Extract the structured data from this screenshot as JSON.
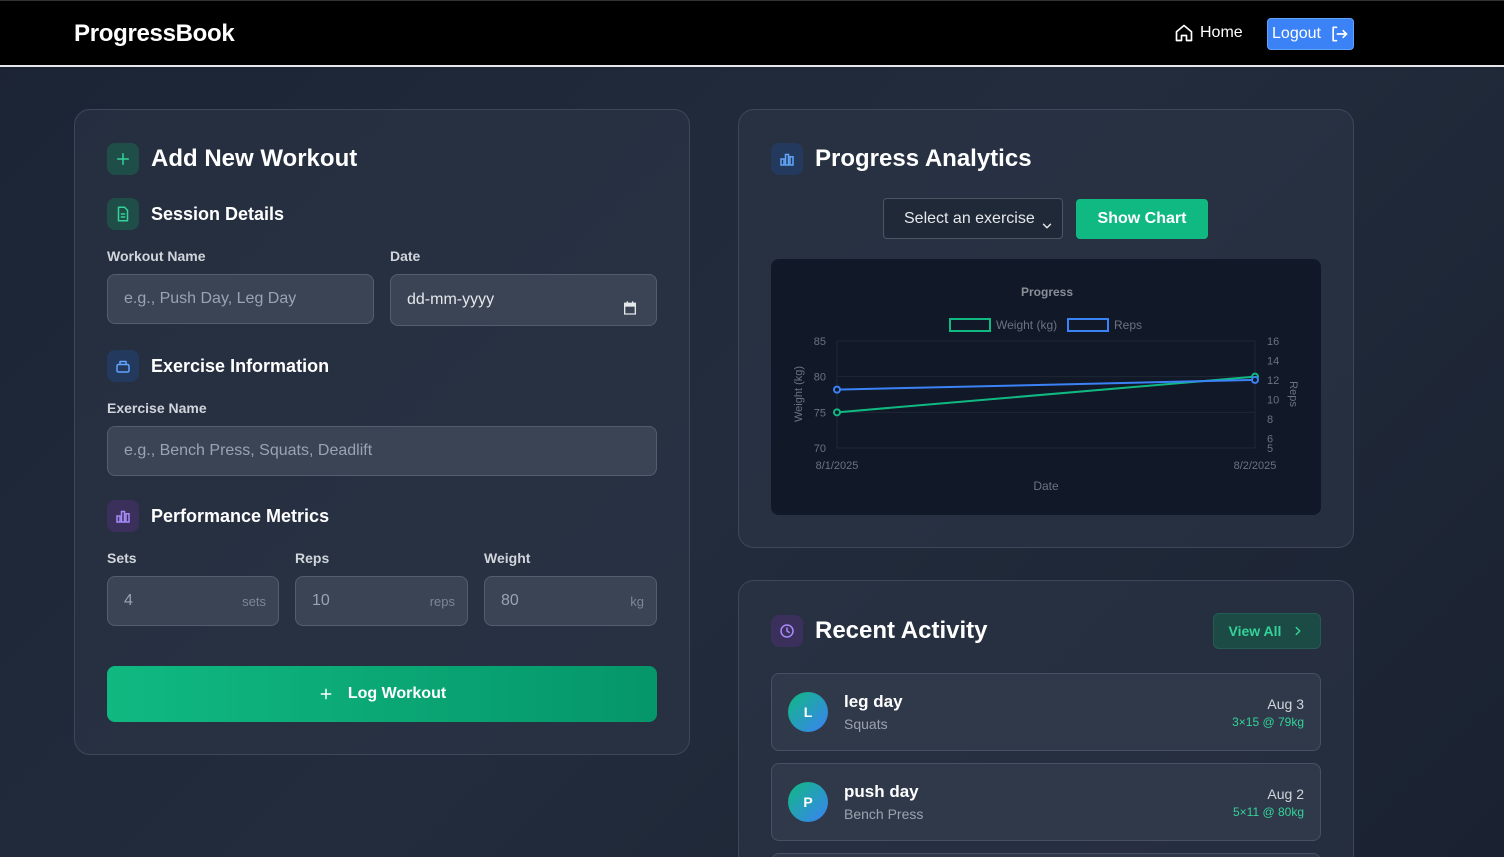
{
  "app": {
    "brand": "ProgressBook"
  },
  "nav": {
    "home_label": "Home",
    "logout_label": "Logout"
  },
  "add_workout": {
    "title": "Add New Workout",
    "session": {
      "title": "Session Details",
      "workout_name_label": "Workout Name",
      "workout_name_placeholder": "e.g., Push Day, Leg Day",
      "date_label": "Date",
      "date_value": "dd-mm-yyyy"
    },
    "exercise": {
      "title": "Exercise Information",
      "name_label": "Exercise Name",
      "name_placeholder": "e.g., Bench Press, Squats, Deadlift"
    },
    "metrics": {
      "title": "Performance Metrics",
      "sets_label": "Sets",
      "sets_placeholder": "4",
      "sets_unit": "sets",
      "reps_label": "Reps",
      "reps_placeholder": "10",
      "reps_unit": "reps",
      "weight_label": "Weight",
      "weight_placeholder": "80",
      "weight_unit": "kg"
    },
    "submit_label": "Log Workout"
  },
  "analytics": {
    "title": "Progress Analytics",
    "select_value": "Select an exercise",
    "show_chart_label": "Show Chart"
  },
  "chart_data": {
    "type": "line",
    "title": "Progress",
    "categories": [
      "8/1/2025",
      "8/2/2025"
    ],
    "xlabel": "Date",
    "ylabel": "Weight (kg)",
    "y2label": "Reps",
    "ylim": [
      70,
      85
    ],
    "y2lim": [
      5,
      16
    ],
    "yticks": [
      70,
      75,
      80,
      85
    ],
    "y2ticks": [
      5,
      6,
      8,
      10,
      12,
      14,
      16
    ],
    "legend": "top",
    "series": [
      {
        "name": "Weight (kg)",
        "axis": "left",
        "color": "#10b981",
        "values": [
          75,
          80
        ]
      },
      {
        "name": "Reps",
        "axis": "right",
        "color": "#3b82f6",
        "values": [
          11,
          12
        ]
      }
    ]
  },
  "recent": {
    "title": "Recent Activity",
    "view_all_label": "View All",
    "items": [
      {
        "initial": "L",
        "name": "leg day",
        "exercise": "Squats",
        "date": "Aug 3",
        "stats": "3×15 @ 79kg"
      },
      {
        "initial": "P",
        "name": "push day",
        "exercise": "Bench Press",
        "date": "Aug 2",
        "stats": "5×11 @ 80kg"
      }
    ]
  },
  "colors": {
    "accent": "#10b981",
    "primary": "#3b82f6",
    "nav_bg": "#000000"
  }
}
